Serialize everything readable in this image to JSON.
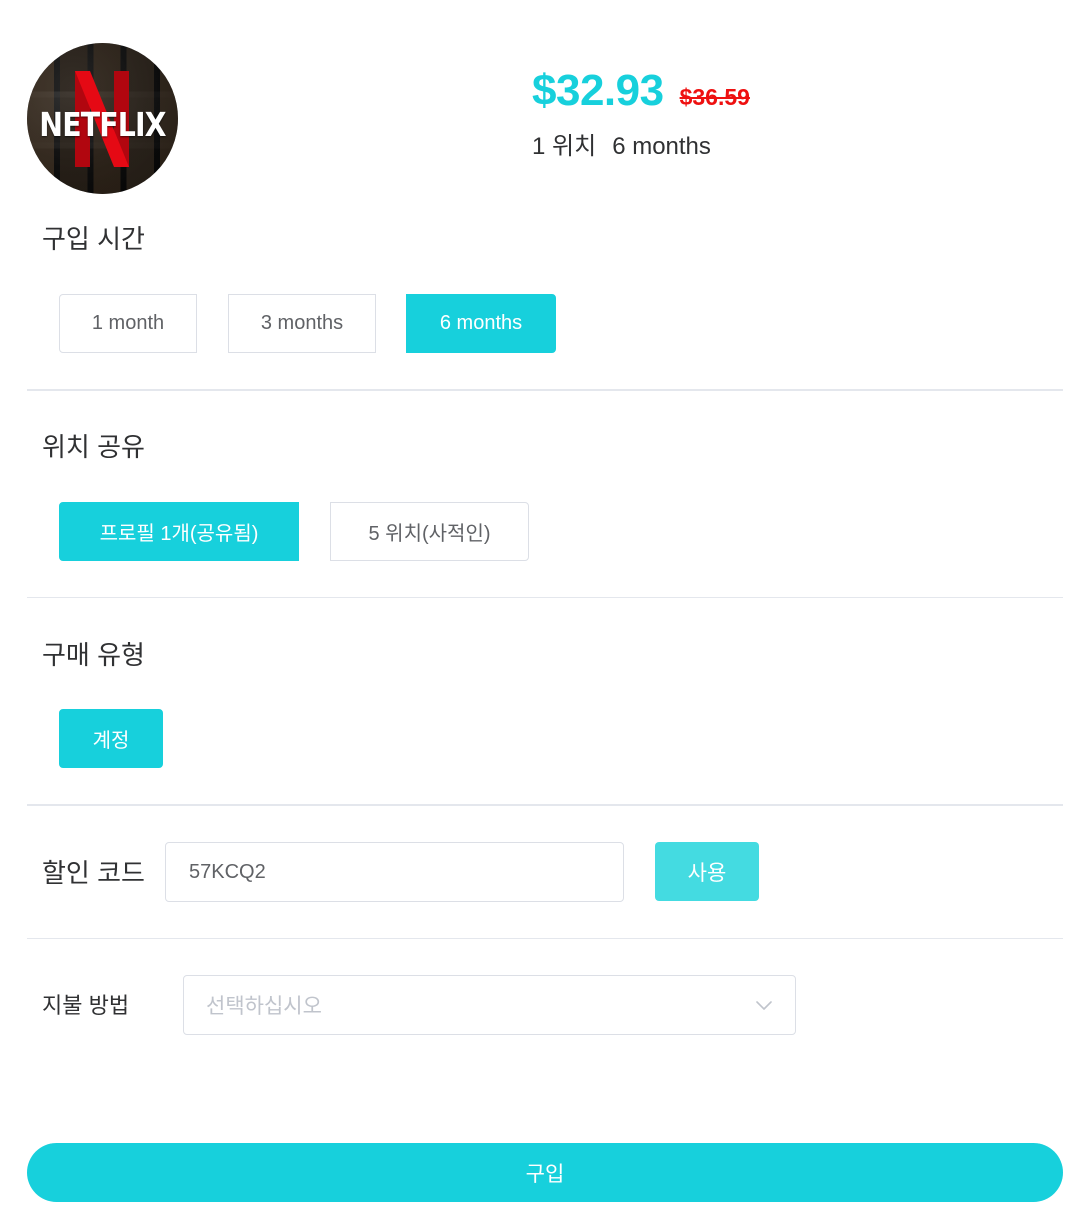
{
  "product": {
    "logo_text": "NETFLIX",
    "price": "$32.93",
    "original_price": "$36.59",
    "summary_seats": "1 위치",
    "summary_duration": "6 months"
  },
  "purchase_time": {
    "title": "구입 시간",
    "options": [
      "1 month",
      "3 months",
      "6 months"
    ],
    "selected": "6 months"
  },
  "seat_sharing": {
    "title": "위치 공유",
    "options": [
      "프로필 1개(공유됨)",
      "5 위치(사적인)"
    ],
    "selected": "프로필 1개(공유됨)"
  },
  "purchase_type": {
    "title": "구매 유형",
    "options": [
      "계정"
    ],
    "selected": "계정"
  },
  "discount": {
    "label": "할인 코드",
    "value": "57KCQ2",
    "apply_label": "사용"
  },
  "payment": {
    "label": "지불 방법",
    "placeholder": "선택하십시오"
  },
  "buy_label": "구입",
  "colors": {
    "accent": "#17d0dc",
    "apply_button": "#44dbe1",
    "old_price": "#ee1010",
    "netflix_red": "#e50914"
  },
  "icons": {
    "select_arrow": "chevron-down-icon"
  }
}
